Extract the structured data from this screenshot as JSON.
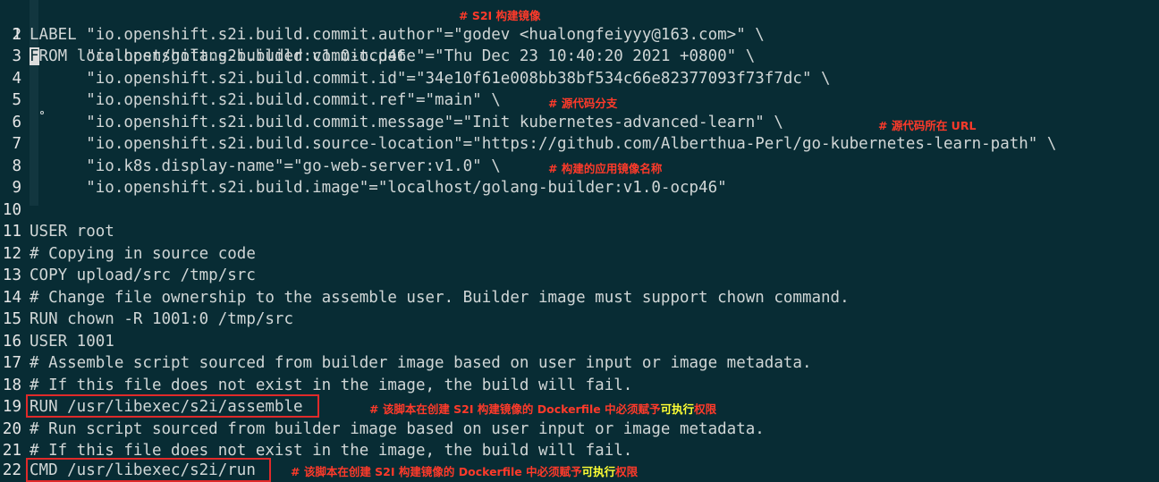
{
  "lines": [
    {
      "n": "1",
      "text": "FROM localhost/golang-builder:v1.0-ocp46"
    },
    {
      "n": "2",
      "text": "LABEL \"io.openshift.s2i.build.commit.author\"=\"godev <hualongfeiyyy@163.com>\" \\"
    },
    {
      "n": "3",
      "text": "      \"io.openshift.s2i.build.commit.date\"=\"Thu Dec 23 10:40:20 2021 +0800\" \\"
    },
    {
      "n": "4",
      "text": "      \"io.openshift.s2i.build.commit.id\"=\"34e10f61e008bb38bf534c66e82377093f73f7dc\" \\"
    },
    {
      "n": "5",
      "text": "      \"io.openshift.s2i.build.commit.ref\"=\"main\" \\"
    },
    {
      "n": "6",
      "text": "      \"io.openshift.s2i.build.commit.message\"=\"Init kubernetes-advanced-learn\" \\"
    },
    {
      "n": "7",
      "text": "      \"io.openshift.s2i.build.source-location\"=\"https://github.com/Alberthua-Perl/go-kubernetes-learn-path\" \\"
    },
    {
      "n": "8",
      "text": "      \"io.k8s.display-name\"=\"go-web-server:v1.0\" \\"
    },
    {
      "n": "9",
      "text": "      \"io.openshift.s2i.build.image\"=\"localhost/golang-builder:v1.0-ocp46\""
    },
    {
      "n": "10",
      "text": ""
    },
    {
      "n": "11",
      "text": "USER root"
    },
    {
      "n": "12",
      "text": "# Copying in source code"
    },
    {
      "n": "13",
      "text": "COPY upload/src /tmp/src"
    },
    {
      "n": "14",
      "text": "# Change file ownership to the assemble user. Builder image must support chown command."
    },
    {
      "n": "15",
      "text": "RUN chown -R 1001:0 /tmp/src"
    },
    {
      "n": "16",
      "text": "USER 1001"
    },
    {
      "n": "17",
      "text": "# Assemble script sourced from builder image based on user input or image metadata."
    },
    {
      "n": "18",
      "text": "# If this file does not exist in the image, the build will fail."
    },
    {
      "n": "19",
      "text": "RUN /usr/libexec/s2i/assemble"
    },
    {
      "n": "20",
      "text": "# Run script sourced from builder image based on user input or image metadata."
    },
    {
      "n": "21",
      "text": "# If this file does not exist in the image, the build will fail."
    },
    {
      "n": "22",
      "text": "CMD /usr/libexec/s2i/run"
    }
  ],
  "annotations": {
    "line1": "# S2I 构建镜像",
    "line5": "# 源代码分支",
    "line6": "# 源代码所在 URL",
    "line8": "# 构建的应用镜像名称",
    "line19_pre": "# 该脚本在创建 S2I 构建镜像的 Dockerfile 中必须赋予",
    "line19_hl": "可执行",
    "line19_post": "权限",
    "line22_pre": "# 该脚本在创建 S2I 构建镜像的 Dockerfile 中必须赋予",
    "line22_hl": "可执行",
    "line22_post": "权限"
  },
  "colors": {
    "background": "#082c34",
    "annotation": "#ff3a2a",
    "highlight": "#ffff33",
    "box": "#e02a2a"
  }
}
